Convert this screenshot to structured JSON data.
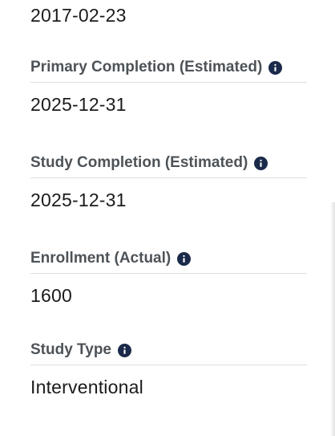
{
  "start_value": "2017-02-23",
  "fields": [
    {
      "label": "Primary Completion (Estimated)",
      "value": "2025-12-31"
    },
    {
      "label": "Study Completion (Estimated)",
      "value": "2025-12-31"
    },
    {
      "label": "Enrollment (Actual)",
      "value": "1600"
    },
    {
      "label": "Study Type",
      "value": "Interventional"
    }
  ],
  "icon": {
    "name": "info-icon",
    "color": "#1b2a4a"
  },
  "colors": {
    "label": "#4d5358",
    "value": "#1b1b1b",
    "divider": "#dcdee0"
  }
}
